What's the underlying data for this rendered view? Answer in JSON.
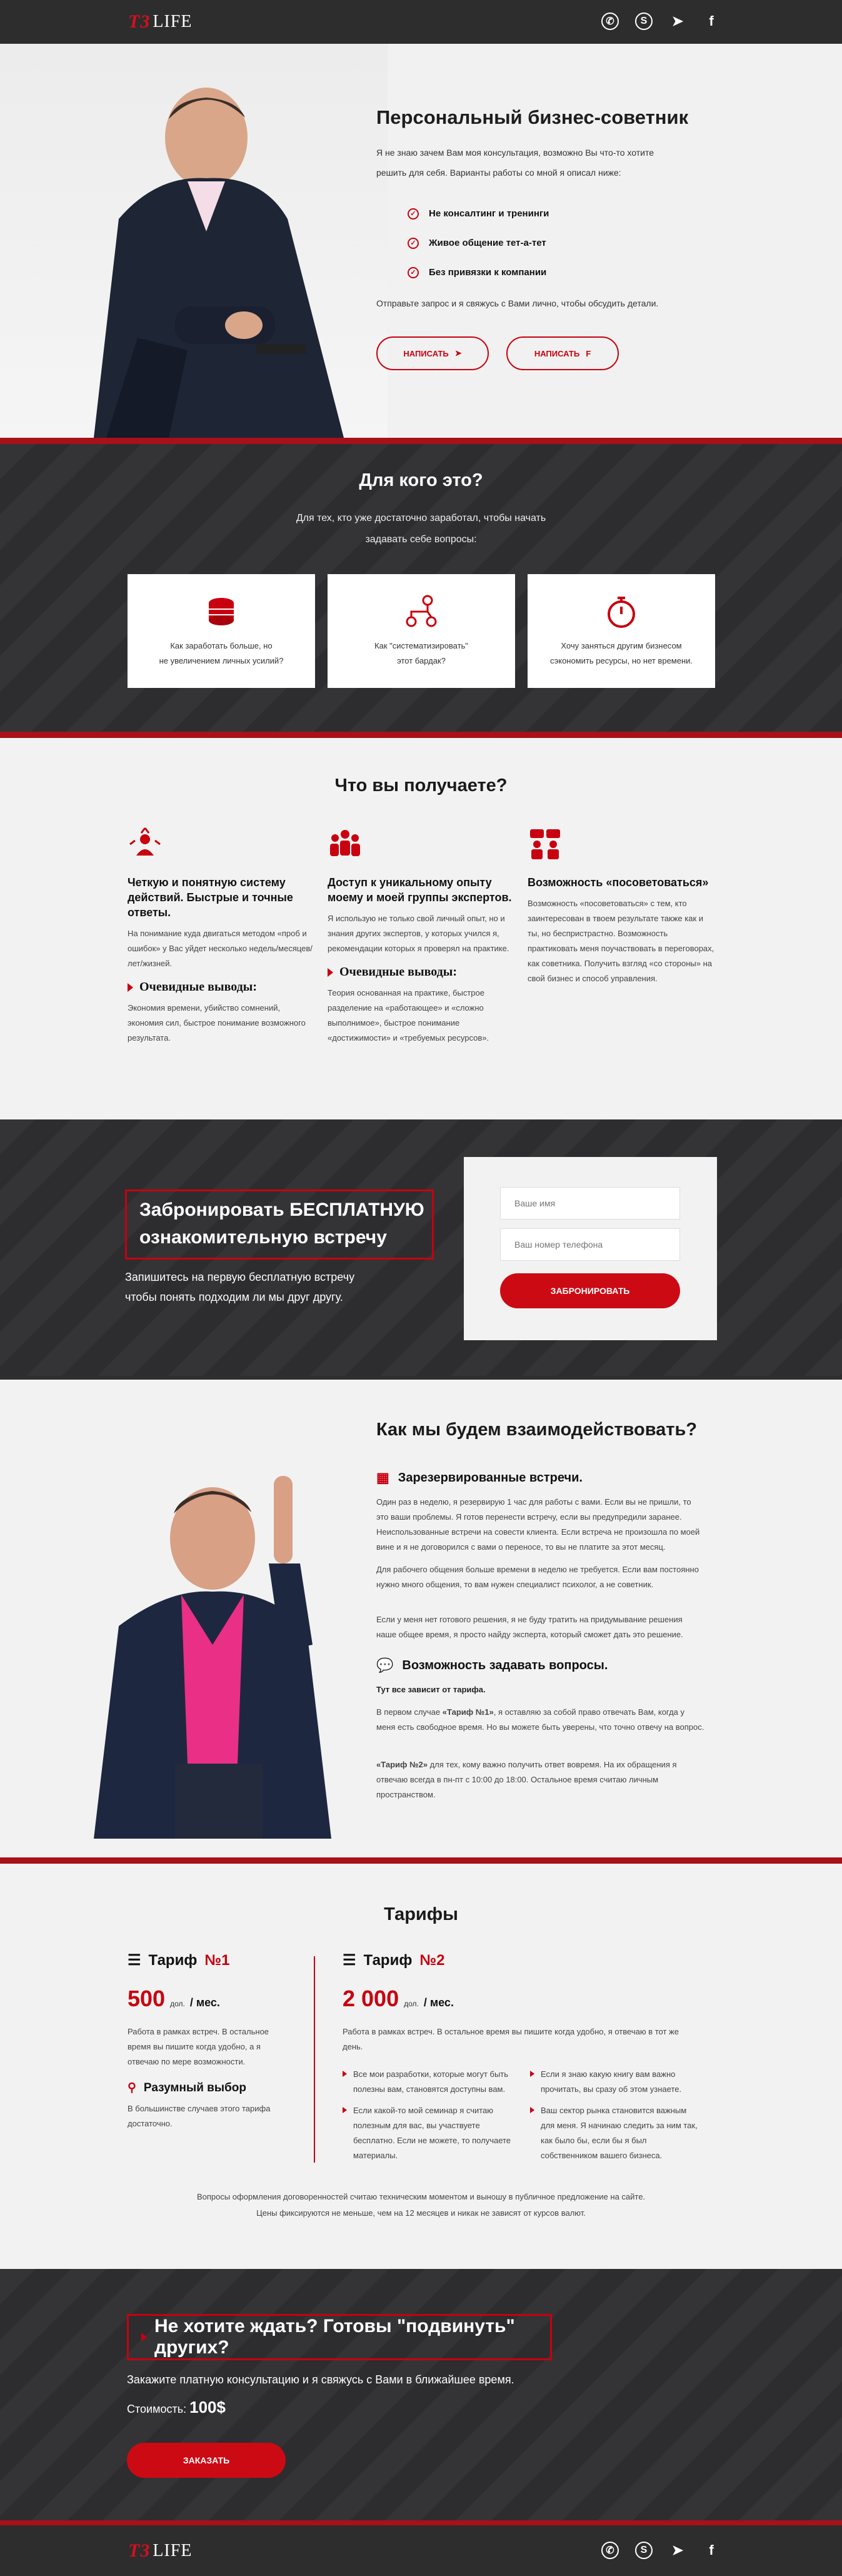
{
  "header": {
    "logo_mark": "T3",
    "logo_text": "LIFE"
  },
  "socials": [
    {
      "icon": "whatsapp-icon",
      "glyph": "✆"
    },
    {
      "icon": "skype-icon",
      "glyph": "S"
    },
    {
      "icon": "telegram-icon",
      "glyph": "➤"
    },
    {
      "icon": "facebook-icon",
      "glyph": "f"
    }
  ],
  "hero": {
    "title": "Персональный бизнес-советник",
    "intro": "Я не знаю зачем Вам моя консультация, возможно Вы что-то хотите решить для себя. Варианты работы со мной я описал ниже:",
    "checks": [
      "Не консалтинг и тренинги",
      "Живое общение тет-а-тет",
      "Без привязки к компании"
    ],
    "send": "Отправьте запрос и я свяжусь с Вами лично, чтобы обсудить детали.",
    "btn_telegram": "Написать",
    "btn_facebook": "Написать"
  },
  "who": {
    "title": "Для кого это?",
    "sub1": "Для тех, кто уже достаточно заработал, чтобы начать",
    "sub2": "задавать себе вопросы:",
    "cards": [
      {
        "icon": "coins-icon",
        "l1": "Как заработать больше, но",
        "l2": "не увеличением личных усилий?"
      },
      {
        "icon": "workflow-icon",
        "l1": "Как \"систематизировать\"",
        "l2": "этот бардак?"
      },
      {
        "icon": "timer-icon",
        "l1": "Хочу заняться другим бизнесом",
        "l2": "сэкономить ресурсы, но нет времени."
      }
    ]
  },
  "benefits": {
    "title": "Что вы получаете?",
    "cols": [
      {
        "icon": "target-person-icon",
        "h": "Четкую и понятную систему действий. Быстрые и точные ответы.",
        "p": "На понимание куда двигаться методом «проб и ошибок» у Вас уйдет несколько недель/месяцев/лет/жизней.",
        "h2": "Очевидные выводы:",
        "p2": "Экономия времени, убийство сомнений, экономия сил, быстрое понимание возможного результата."
      },
      {
        "icon": "team-icon",
        "h": "Доступ к уникальному опыту моему и моей группы экспертов.",
        "p": "Я использую не только свой личный опыт, но и знания других экспертов, у которых учился я, рекомендации которых я проверял на практике.",
        "h2": "Очевидные выводы:",
        "p2": "Теория основанная на практике, быстрое разделение на «работающее» и «сложно выполнимое», быстрое понимание «достижимости» и «требуемых ресурсов»."
      },
      {
        "icon": "advisors-icon",
        "h": "Возможность «посоветоваться»",
        "p": "Возможность «посоветоваться» с тем, кто заинтересован в твоем результате также как и ты, но беспристрастно. Возможность практиковать меня поучаствовать в переговорах, как советника. Получить взгляд «со стороны» на свой бизнес и способ управления."
      }
    ]
  },
  "booking": {
    "title1": "Забронировать БЕСПЛАТНУЮ",
    "title2": "ознакомительную встречу",
    "sub1": "Запишитесь на первую бесплатную встречу",
    "sub2": "чтобы понять подходим ли мы друг другу.",
    "name_placeholder": "Ваше имя",
    "phone_placeholder": "Ваш номер телефона",
    "submit": "Забронировать"
  },
  "interaction": {
    "title": "Как мы будем взаимодействовать?",
    "h1": "Зарезервированные встречи.",
    "p1": "Один раз в неделю, я резервирую 1 час для работы с вами. Если вы не пришли, то это ваши проблемы. Я готов перенести встречу, если вы предупредили заранее. Неиспользованные встречи на совести клиента. Если встреча не произошла по моей вине и я не договорился с вами о переносе, то вы не платите за этот месяц.",
    "p2": "Для рабочего общения больше времени в неделю не требуется. Если вам постоянно нужно много общения, то вам нужен специалист психолог, а не советник.",
    "p3": "Если у меня нет готового решения, я не буду тратить на придумывание решения наше общее время, я просто найду эксперта, который сможет дать это решение.",
    "h2": "Возможность задавать вопросы.",
    "p4": "Тут все зависит от тарифа.",
    "p5a": "В первом случае ",
    "p5b": "«Тариф №1»",
    "p5c": ", я оставляю за собой право отвечать Вам, когда у меня есть свободное время. Но вы можете быть уверены, что точно отвечу на вопрос.",
    "p6a": "«Тариф №2»",
    "p6b": " для тех, кому важно получить ответ вовремя. На их обращения я отвечаю всегда в пн-пт с 10:00 до 18:00. Остальное время считаю личным пространством."
  },
  "tariffs": {
    "title": "Тарифы",
    "t1": {
      "name": "Тариф ",
      "num": "№1",
      "price": "500",
      "cur": "дол.",
      "per": "/ мес.",
      "p": "Работа в рамках встреч. В остальное время вы пишите когда удобно, а я отвечаю по мере возможности.",
      "sub": "Разумный выбор",
      "sub_p": "В большинстве случаев этого тарифа достаточно."
    },
    "t2": {
      "name": "Тариф ",
      "num": "№2",
      "price": "2 000",
      "cur": "дол.",
      "per": "/ мес.",
      "p": "Работа в рамках встреч. В остальное время вы пишите когда удобно, я отвечаю в тот же день.",
      "b1": "Все мои разработки, которые могут быть полезны вам, становятся доступны вам.",
      "b2": "Если какой-то мой семинар я считаю полезным для вас, вы участвуете бесплатно. Если не можете, то получаете материалы.",
      "b3": "Если я знаю какую книгу вам важно прочитать, вы сразу об этом узнаете.",
      "b4": "Ваш сектор рынка становится важным для меня. Я начинаю следить за ним так, как было бы, если бы я был собственником вашего бизнеса."
    },
    "note1": "Вопросы оформления договоренностей считаю техническим моментом и выношу в публичное предложение на сайте.",
    "note2": "Цены фиксируются не меньше, чем на 12 месяцев и никак не зависят от курсов валют."
  },
  "cta": {
    "title": "Не хотите ждать? Готовы \"подвинуть\" других?",
    "sub": "Закажите платную консультацию и я свяжусь с Вами в ближайшее время.",
    "cost_label": "Стоимость: ",
    "cost": "100$",
    "btn": "Заказать"
  },
  "colors": {
    "accent": "#c8000f",
    "dark": "#2f2f31",
    "light": "#f2f2f2"
  }
}
